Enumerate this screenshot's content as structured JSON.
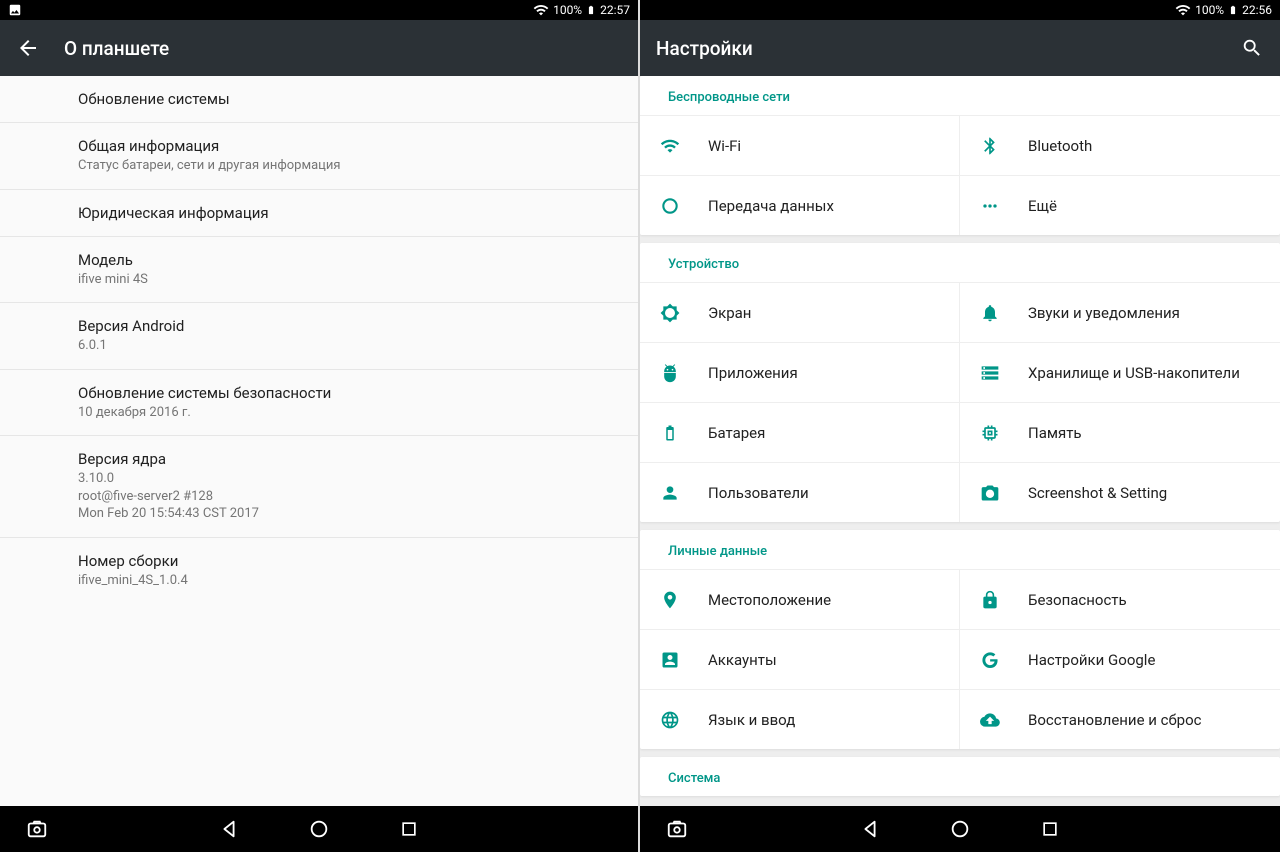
{
  "left": {
    "status": {
      "battery": "100%",
      "time": "22:57"
    },
    "toolbar": {
      "title": "О планшете"
    },
    "rows": [
      {
        "primary": "Обновление системы"
      },
      {
        "primary": "Общая информация",
        "secondary": "Статус батареи, сети и другая информация"
      },
      {
        "primary": "Юридическая информация"
      },
      {
        "primary": "Модель",
        "secondary": "ifive mini 4S"
      },
      {
        "primary": "Версия Android",
        "secondary": "6.0.1"
      },
      {
        "primary": "Обновление системы безопасности",
        "secondary": "10 декабря 2016 г."
      },
      {
        "primary": "Версия ядра",
        "secondary": "3.10.0\nroot@five-server2 #128\nMon Feb 20 15:54:43 CST 2017"
      },
      {
        "primary": "Номер сборки",
        "secondary": "ifive_mini_4S_1.0.4"
      }
    ]
  },
  "right": {
    "status": {
      "battery": "100%",
      "time": "22:56"
    },
    "toolbar": {
      "title": "Настройки"
    },
    "sections": [
      {
        "header": "Беспроводные сети",
        "tiles": [
          {
            "icon": "wifi",
            "label": "Wi-Fi"
          },
          {
            "icon": "bluetooth",
            "label": "Bluetooth"
          },
          {
            "icon": "data-usage",
            "label": "Передача данных"
          },
          {
            "icon": "more",
            "label": "Ещё"
          }
        ]
      },
      {
        "header": "Устройство",
        "tiles": [
          {
            "icon": "display",
            "label": "Экран"
          },
          {
            "icon": "notifications",
            "label": "Звуки и уведомления"
          },
          {
            "icon": "apps",
            "label": "Приложения"
          },
          {
            "icon": "storage",
            "label": "Хранилище и USB-накопители"
          },
          {
            "icon": "battery",
            "label": "Батарея"
          },
          {
            "icon": "memory",
            "label": "Память"
          },
          {
            "icon": "users",
            "label": "Пользователи"
          },
          {
            "icon": "screenshot",
            "label": "Screenshot & Setting"
          }
        ]
      },
      {
        "header": "Личные данные",
        "tiles": [
          {
            "icon": "location",
            "label": "Местоположение"
          },
          {
            "icon": "security",
            "label": "Безопасность"
          },
          {
            "icon": "accounts",
            "label": "Аккаунты"
          },
          {
            "icon": "google",
            "label": "Настройки Google"
          },
          {
            "icon": "language",
            "label": "Язык и ввод"
          },
          {
            "icon": "backup",
            "label": "Восстановление и сброс"
          }
        ]
      },
      {
        "header": "Система",
        "tiles": []
      }
    ]
  }
}
